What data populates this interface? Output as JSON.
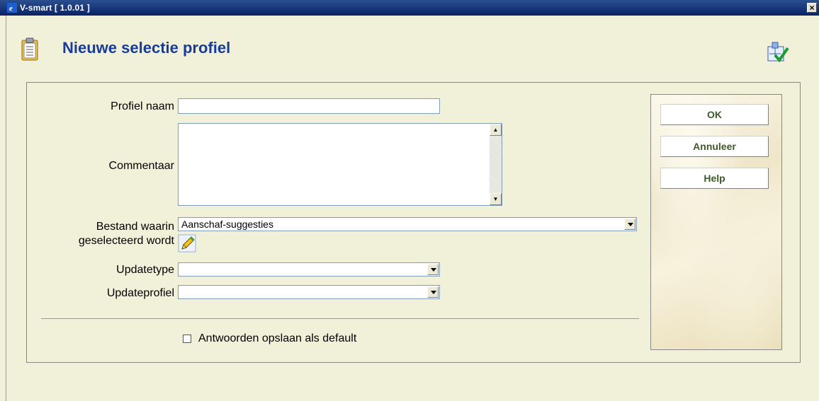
{
  "window": {
    "title": "V-smart [ 1.0.01 ]",
    "close_label": "×"
  },
  "page": {
    "heading": "Nieuwe selectie profiel"
  },
  "form": {
    "profile_name_label": "Profiel naam",
    "profile_name_value": "",
    "comment_label": "Commentaar",
    "comment_value": "",
    "file_label_line1": "Bestand waarin",
    "file_label_line2": "geselecteerd wordt",
    "file_value": "Aanschaf-suggesties",
    "update_type_label": "Updatetype",
    "update_type_value": "",
    "update_profile_label": "Updateprofiel",
    "update_profile_value": "",
    "save_default_label": "Antwoorden opslaan als default",
    "save_default_checked": false
  },
  "buttons": {
    "ok": "OK",
    "cancel": "Annuleer",
    "help": "Help"
  },
  "icons": {
    "app": "ie-icon",
    "heading": "clipboard-icon",
    "help": "help-navigator-icon",
    "edit": "pencil-icon"
  }
}
